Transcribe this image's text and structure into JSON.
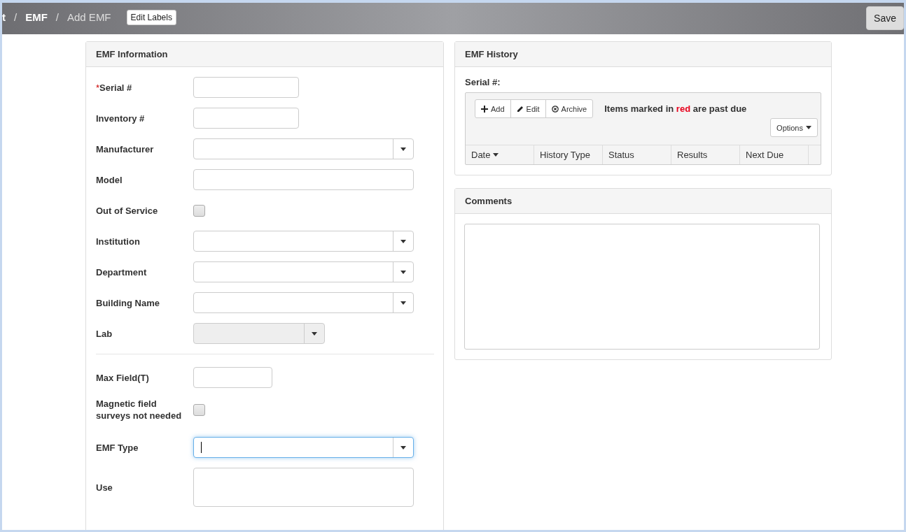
{
  "breadcrumb": [
    {
      "label": "t",
      "current": false
    },
    {
      "separator": "/",
      "label": "EMF",
      "current": false
    },
    {
      "separator": "/",
      "label": "Add EMF",
      "current": true
    }
  ],
  "edit_labels_button": "Edit Labels",
  "save_button": "Save",
  "emf_information": {
    "title": "EMF Information",
    "sections": [
      [
        {
          "required_mark": "*",
          "label": "Serial #",
          "kind": "mediumtext"
        },
        {
          "label": "Inventory #",
          "kind": "mediumtext"
        },
        {
          "label": "Manufacturer",
          "kind": "select"
        },
        {
          "label": "Model",
          "kind": "widetext"
        },
        {
          "label": "Out of Service",
          "kind": "checkbox",
          "checked": false
        },
        {
          "label": "Institution",
          "kind": "select"
        },
        {
          "label": "Department",
          "kind": "select"
        },
        {
          "label": "Building Name",
          "kind": "select"
        },
        {
          "label": "Lab",
          "kind": "narrowselect",
          "disabled": true
        }
      ],
      [
        {
          "label": "Max Field(T)",
          "kind": "shorttext"
        },
        {
          "label": "Magnetic field surveys not needed",
          "kind": "checkbox",
          "checked": false
        },
        {
          "label": "EMF Type",
          "kind": "select",
          "focused": true
        },
        {
          "label": "Use",
          "kind": "textarea"
        }
      ]
    ]
  },
  "emf_history": {
    "title": "EMF History",
    "serial_label": "Serial #:",
    "toolbar": [
      {
        "label": "Add",
        "kind": "plus"
      },
      {
        "label": "Edit",
        "kind": "pencil"
      },
      {
        "label": "Archive",
        "kind": "circle-x"
      }
    ],
    "message": {
      "before": "Items marked in",
      "highlight": "red",
      "after": "are past due"
    },
    "options_button": "Options",
    "columns": [
      {
        "label": "Date",
        "sorted": true
      },
      {
        "label": "History Type",
        "sorted": false
      },
      {
        "label": "Status",
        "sorted": false
      },
      {
        "label": "Results",
        "sorted": false
      },
      {
        "label": "Next Due",
        "sorted": false
      }
    ]
  },
  "comments": {
    "title": "Comments"
  }
}
